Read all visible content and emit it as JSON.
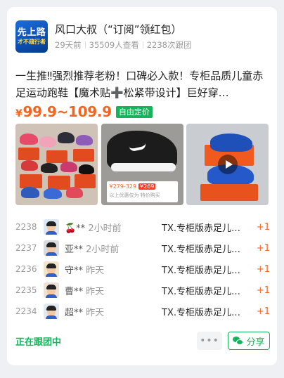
{
  "group": {
    "name": "风口大叔（“订阅”领红包）",
    "avatar_text": [
      "先上路",
      "才不疏行者"
    ],
    "meta": [
      "29天前",
      "35509人查看",
      "2238次跟团"
    ]
  },
  "product": {
    "title": "一生推‼强烈推荐老粉！口碑必入款！专柜品质儿童赤足运动跑鞋【魔术贴➕松紧带设计】巨好穿…",
    "price": "¥99.9~109.9",
    "price_tag": "自由定价",
    "images": [
      {
        "name": "colorful-kids-shoes"
      },
      {
        "name": "black-nike-shoe",
        "promo_price": "¥279-329",
        "promo_chip": "¥269",
        "promo_note": "以上优惠仅为 特价购买"
      },
      {
        "name": "blue-shoes-video"
      }
    ]
  },
  "records": [
    {
      "no": "2238",
      "name": "🍒**",
      "time": "2小时前",
      "product": "TX.专柜版赤足儿…",
      "count": "+1",
      "avatar_bg": "#dbe7f5"
    },
    {
      "no": "2237",
      "name": "亚**",
      "time": "2小时前",
      "product": "TX.专柜版赤足儿…",
      "count": "+1",
      "avatar_bg": "#d7dbe0"
    },
    {
      "no": "2236",
      "name": "守**",
      "time": "昨天",
      "product": "TX.专柜版赤足儿…",
      "count": "+1",
      "avatar_bg": "#f3e4c9"
    },
    {
      "no": "2235",
      "name": "曹**",
      "time": "昨天",
      "product": "TX.专柜版赤足儿…",
      "count": "+1",
      "avatar_bg": "#ede2d4"
    },
    {
      "no": "2234",
      "name": "超**",
      "time": "昨天",
      "product": "TX.专柜版赤足儿…",
      "count": "+1",
      "avatar_bg": "#e3e8ef"
    }
  ],
  "footer": {
    "status": "正在跟团中",
    "more_label": "•••",
    "share_label": "分享"
  },
  "colors": {
    "accent_green": "#16b45a",
    "price_orange": "#f5641e"
  }
}
